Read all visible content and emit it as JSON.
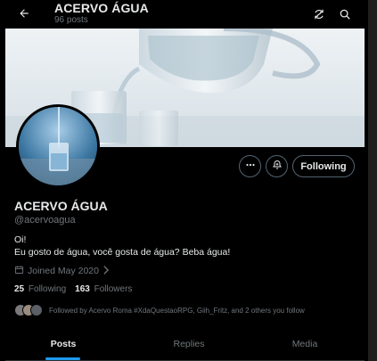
{
  "header": {
    "title": "ACERVO ÁGUA",
    "posts_count": "96 posts"
  },
  "profile": {
    "name": "ACERVO ÁGUA",
    "handle": "@acervoagua",
    "bio_line1": "Oi!",
    "bio_line2": "Eu gosto de água, você gosta de água? Beba água!",
    "joined": "Joined May 2020",
    "following_count": "25",
    "following_label": "Following",
    "followers_count": "163",
    "followers_label": "Followers",
    "followed_by": "Followed by Acervo Roma #XdaQuestaoRPG, Giih_Fritz, and 2 others you follow"
  },
  "actions": {
    "following_button": "Following"
  },
  "tabs": [
    {
      "label": "Posts",
      "active": true
    },
    {
      "label": "Replies",
      "active": false
    },
    {
      "label": "Media",
      "active": false
    }
  ],
  "colors": {
    "accent": "#1d9bf0",
    "text": "#e7e9ea",
    "muted": "#71767b",
    "border": "#536471"
  },
  "icons": [
    "back-arrow-icon",
    "sync-icon",
    "search-icon",
    "more-icon",
    "notification-plus-icon",
    "calendar-icon",
    "chevron-right-icon"
  ]
}
